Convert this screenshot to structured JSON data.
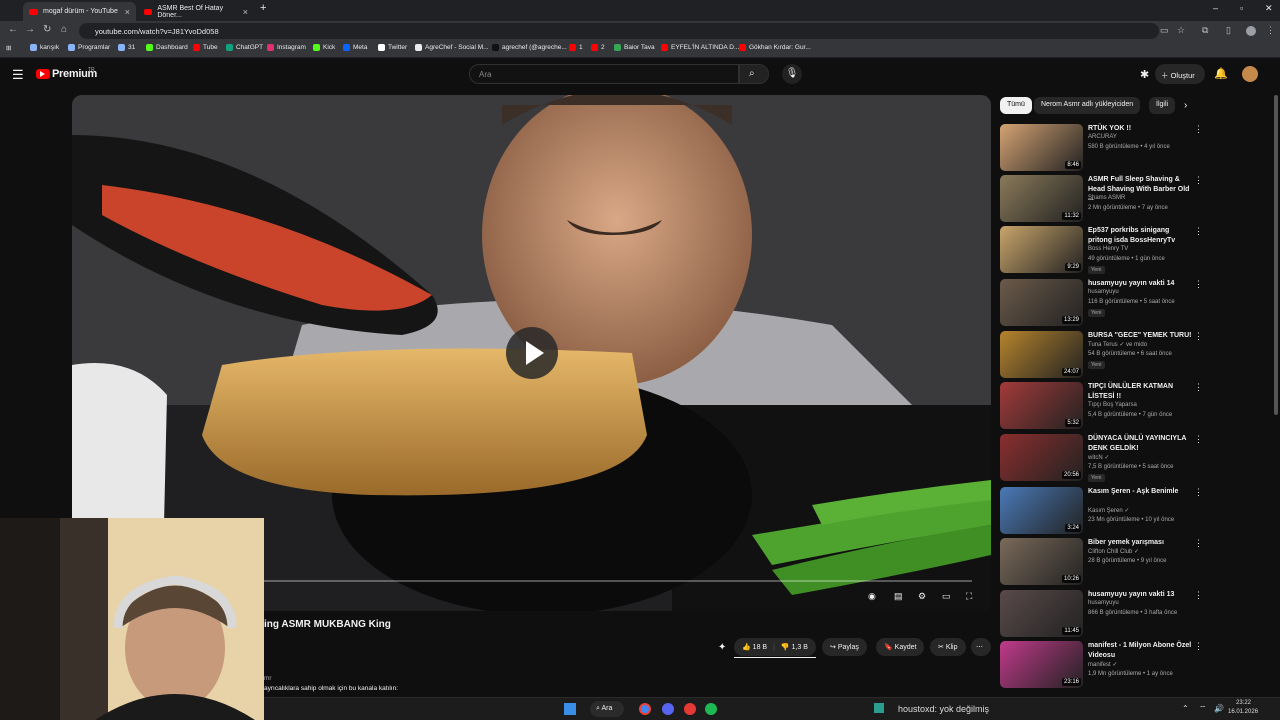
{
  "browser": {
    "tabs": [
      {
        "title": "mogaf dürüm - YouTube"
      },
      {
        "title": "ASMR Best Of Hatay Döner..."
      }
    ],
    "new_tab": "+",
    "close": "×",
    "url": "youtube.com/watch?v=J81YvoDd058",
    "bookmarks": [
      {
        "label": "karışık",
        "color": "#8ab4f8"
      },
      {
        "label": "Programlar",
        "color": "#8ab4f8"
      },
      {
        "label": "31",
        "color": "#8ab4f8"
      },
      {
        "label": "Dashboard",
        "color": "#53fc18"
      },
      {
        "label": "Tube",
        "color": "#ff0000"
      },
      {
        "label": "ChatGPT",
        "color": "#10a37f"
      },
      {
        "label": "Instagram",
        "color": "#e1306c"
      },
      {
        "label": "Kick",
        "color": "#53fc18"
      },
      {
        "label": "Meta",
        "color": "#0866ff"
      },
      {
        "label": "Twitter",
        "color": "#ffffff"
      },
      {
        "label": "AgreChef - Social M...",
        "color": "#e8eaed"
      },
      {
        "label": "agrechef (@agreche...",
        "color": "#000000"
      },
      {
        "label": "1",
        "color": "#ff0000"
      },
      {
        "label": "2",
        "color": "#ff0000"
      },
      {
        "label": "Baior Tava",
        "color": "#34a853"
      },
      {
        "label": "EYFEL'İN ALTINDA D...",
        "color": "#ff0000"
      },
      {
        "label": "Gökhan Kırdar: Gur...",
        "color": "#ff0000"
      }
    ]
  },
  "header": {
    "logo": "Premium",
    "logo_suffix": "TR",
    "search_placeholder": "Ara",
    "create_label": "Oluştur"
  },
  "video": {
    "title_partial": "ing ASMR MUKBANG King",
    "like_count": "18 B",
    "dislike_label": "1,3 B",
    "share_label": "Paylaş",
    "save_label": "Kaydet",
    "clip_label": "Klip",
    "channel_partial": "mr",
    "join_text_partial": "ayrıcalıklara sahip olmak için bu kanala katılın:"
  },
  "chips": [
    {
      "label": "Tümü",
      "active": true
    },
    {
      "label": "Nerom Asmr adlı yükleyiciden",
      "active": false
    },
    {
      "label": "İlgili",
      "active": false
    }
  ],
  "recommendations": [
    {
      "title": "RTÜK YOK !!",
      "channel": "ARCURAY",
      "meta": "580 B görüntüleme • 4 yıl önce",
      "duration": "8:46",
      "new": "",
      "color": "#d4a373"
    },
    {
      "title": "ASMR Full Sleep Shaving & Head Shaving With Barber Old ...",
      "channel": "Shams ASMR",
      "meta": "2 Mn görüntüleme • 7 ay önce",
      "duration": "11:32",
      "new": "",
      "color": "#8a7a5a"
    },
    {
      "title": "Ep537 porkribs sinigang pritong isda BossHenryTv",
      "channel": "Boss Henry TV",
      "meta": "49 görüntüleme • 1 gün önce",
      "duration": "9:29",
      "new": "Yeni",
      "color": "#c9a56b"
    },
    {
      "title": "husamyuyu yayın vakti 14",
      "channel": "husamyuyu",
      "meta": "116 B görüntüleme • 5 saat önce",
      "duration": "13:29",
      "new": "Yeni",
      "color": "#6b5a4a"
    },
    {
      "title": "BURSA \"GECE\" YEMEK TURU!",
      "channel": "Tuna Terus ✓ ve mido",
      "meta": "54 B görüntüleme • 6 saat önce",
      "duration": "24:07",
      "new": "Yeni",
      "color": "#b5842c"
    },
    {
      "title": "TIPÇI ÜNLÜLER KATMAN LİSTESİ !!",
      "channel": "Tıpçı Boş Yaparsa",
      "meta": "5,4 B görüntüleme • 7 gün önce",
      "duration": "5:32",
      "new": "",
      "color": "#a33a3a"
    },
    {
      "title": "DÜNYACA ÜNLÜ YAYINCIYLA DENK GELDİK!",
      "channel": "witcN ✓",
      "meta": "7,5 B görüntüleme • 5 saat önce",
      "duration": "20:56",
      "new": "Yeni",
      "color": "#8b2e2e"
    },
    {
      "title": "Kasım Şeren - Aşk Benimle",
      "channel": "Kasım Şeren ✓",
      "meta": "23 Mn görüntüleme • 10 yıl önce",
      "duration": "3:24",
      "new": "",
      "color": "#4a7ab8"
    },
    {
      "title": "Biber yemek yarışması",
      "channel": "Clifton Chill Club ✓",
      "meta": "28 B görüntüleme • 9 yıl önce",
      "duration": "10:26",
      "new": "",
      "color": "#7a6a5a"
    },
    {
      "title": "husamyuyu yayın vakti 13",
      "channel": "husamyuyu",
      "meta": "866 B görüntüleme • 3 hafta önce",
      "duration": "11:45",
      "new": "",
      "color": "#5a4a4a"
    },
    {
      "title": "manifest - 1 Milyon Abone Özel Videosu",
      "channel": "manifest ✓",
      "meta": "1,9 Mn görüntüleme • 1 ay önce",
      "duration": "23:16",
      "new": "",
      "color": "#c03a8a"
    }
  ],
  "taskbar": {
    "search_label": "Ara",
    "overlay_text": "houstoxd: yok değilmiş",
    "clock_time": "23:22",
    "clock_date": "16.01.2026"
  }
}
